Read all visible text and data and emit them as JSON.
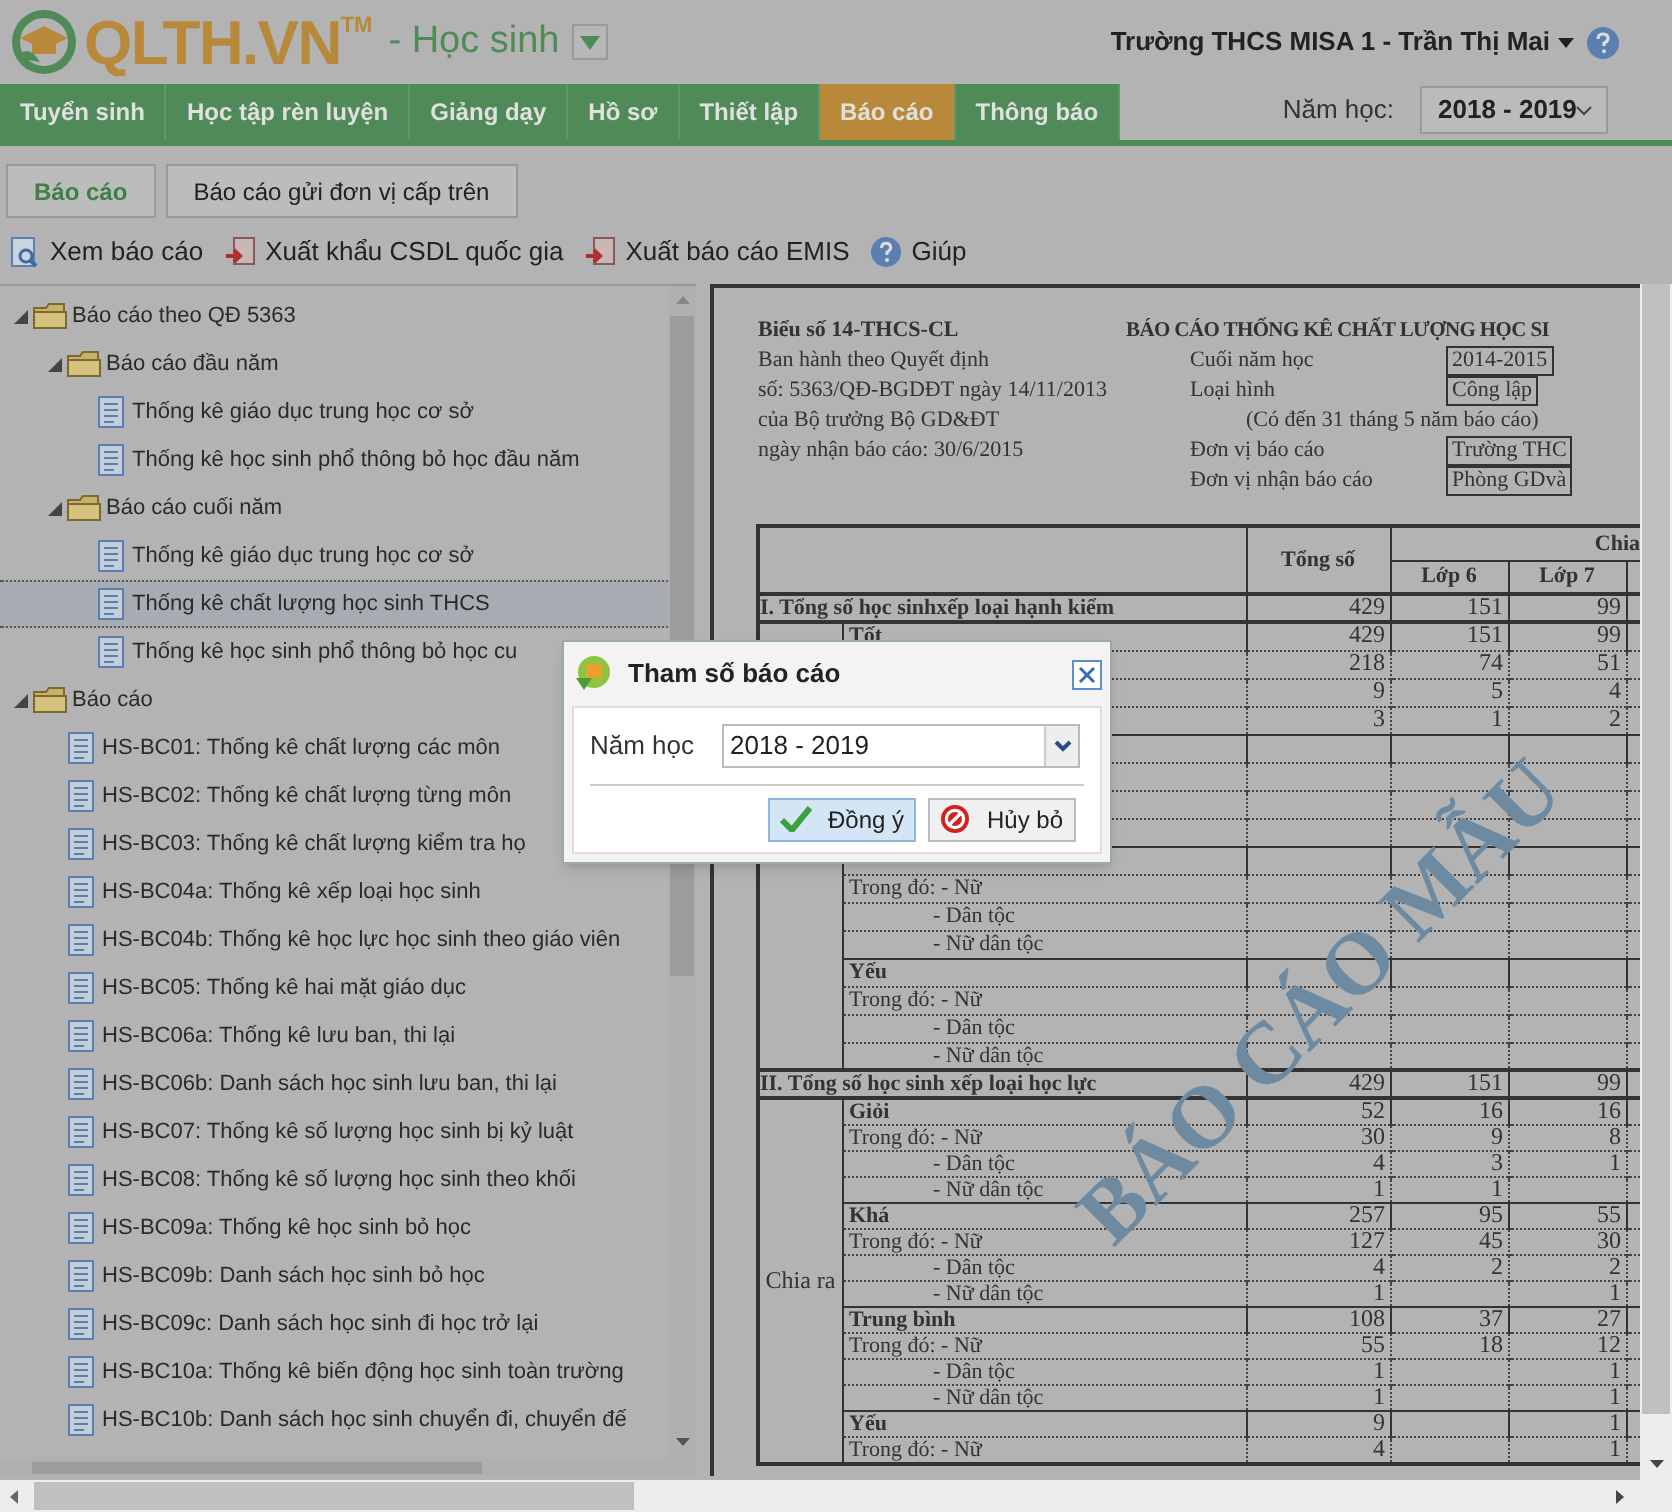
{
  "app": {
    "logo_text": "QLTH.VN",
    "trademark": "TM",
    "module": "- Học sinh"
  },
  "user_menu": {
    "label": "Trường THCS MISA 1 - Trần Thị Mai"
  },
  "nav_tabs": [
    {
      "label": "Tuyển sinh",
      "selected": false
    },
    {
      "label": "Học tập rèn luyện",
      "selected": false
    },
    {
      "label": "Giảng dạy",
      "selected": false
    },
    {
      "label": "Hồ sơ",
      "selected": false
    },
    {
      "label": "Thiết lập",
      "selected": false
    },
    {
      "label": "Báo cáo",
      "selected": true
    },
    {
      "label": "Thông báo",
      "selected": false
    }
  ],
  "school_year": {
    "label": "Năm học:",
    "value": "2018 - 2019"
  },
  "sub_tabs": [
    {
      "label": "Báo cáo",
      "selected": true
    },
    {
      "label": "Báo cáo gửi đơn vị cấp trên",
      "selected": false
    }
  ],
  "toolbar": [
    {
      "kind": "view",
      "label": "Xem báo cáo"
    },
    {
      "kind": "export",
      "label": "Xuất khẩu CSDL quốc gia"
    },
    {
      "kind": "export",
      "label": "Xuất báo cáo EMIS"
    },
    {
      "kind": "help",
      "label": "Giúp"
    }
  ],
  "tree": [
    {
      "kind": "folder",
      "label": "Báo cáo theo QĐ 5363",
      "expanded": true,
      "selected": false,
      "children": [
        {
          "kind": "folder",
          "label": "Báo cáo đầu năm",
          "expanded": true,
          "selected": false,
          "children": [
            {
              "kind": "report",
              "label": "Thống kê giáo dục trung học cơ sở",
              "selected": false
            },
            {
              "kind": "report",
              "label": "Thống kê học sinh phổ thông bỏ học đầu năm",
              "selected": false
            }
          ]
        },
        {
          "kind": "folder",
          "label": "Báo cáo cuối năm",
          "expanded": true,
          "selected": false,
          "children": [
            {
              "kind": "report",
              "label": "Thống kê giáo dục trung học cơ sở",
              "selected": false
            },
            {
              "kind": "report",
              "label": "Thống kê chất lượng học sinh THCS",
              "selected": true
            },
            {
              "kind": "report",
              "label": "Thống kê học sinh phổ thông bỏ học cu",
              "selected": false
            }
          ]
        }
      ]
    },
    {
      "kind": "folder",
      "label": "Báo cáo",
      "expanded": true,
      "selected": false,
      "children": [
        {
          "kind": "report",
          "label": "HS-BC01: Thống kê chất lượng các môn",
          "selected": false
        },
        {
          "kind": "report",
          "label": "HS-BC02: Thống kê chất lượng từng môn",
          "selected": false
        },
        {
          "kind": "report",
          "label": "HS-BC03: Thống kê chất lượng kiểm tra họ",
          "selected": false
        },
        {
          "kind": "report",
          "label": "HS-BC04a: Thống kê xếp loại học sinh",
          "selected": false
        },
        {
          "kind": "report",
          "label": "HS-BC04b: Thống kê học lực học sinh theo giáo viên",
          "selected": false
        },
        {
          "kind": "report",
          "label": "HS-BC05: Thống kê hai mặt giáo dục",
          "selected": false
        },
        {
          "kind": "report",
          "label": "HS-BC06a: Thống kê lưu ban, thi lại",
          "selected": false
        },
        {
          "kind": "report",
          "label": "HS-BC06b: Danh sách học sinh lưu ban, thi lại",
          "selected": false
        },
        {
          "kind": "report",
          "label": "HS-BC07: Thống kê số lượng học sinh bị kỷ luật",
          "selected": false
        },
        {
          "kind": "report",
          "label": "HS-BC08: Thống kê số lượng học sinh theo khối",
          "selected": false
        },
        {
          "kind": "report",
          "label": "HS-BC09a: Thống kê học sinh bỏ học",
          "selected": false
        },
        {
          "kind": "report",
          "label": "HS-BC09b: Danh sách học sinh bỏ học",
          "selected": false
        },
        {
          "kind": "report",
          "label": "HS-BC09c: Danh sách học sinh đi học trở lại",
          "selected": false
        },
        {
          "kind": "report",
          "label": "HS-BC10a: Thống kê biến động học sinh toàn trường",
          "selected": false
        },
        {
          "kind": "report",
          "label": "HS-BC10b: Danh sách học sinh chuyển đi, chuyển đế",
          "selected": false
        }
      ]
    }
  ],
  "report": {
    "form_code": "Biểu số 14-THCS-CL",
    "title": "BÁO CÁO THỐNG KÊ CHẤT LƯỢNG HỌC SI",
    "issued_lines": [
      "Ban hành theo Quyết định",
      "số: 5363/QĐ-BGDĐT ngày 14/11/2013",
      "của Bộ trưởng Bộ GD&ĐT",
      "ngày nhận báo cáo: 30/6/2015"
    ],
    "fields": [
      {
        "kind": "field",
        "label": "Cuối năm học",
        "value": "2014-2015"
      },
      {
        "kind": "field",
        "label": "Loại hình",
        "value": "Công lập"
      },
      {
        "kind": "note",
        "label": "(Có đến 31 tháng 5 năm báo cáo)"
      },
      {
        "kind": "field",
        "label": "Đơn vị báo cáo",
        "value": "Trường THC"
      },
      {
        "kind": "field",
        "label": "Đơn vị nhận báo cáo",
        "value": "Phòng GDvà"
      }
    ],
    "table": {
      "total_header": "Tổng số",
      "group_header": "Chia",
      "grade_headers": [
        "Lớp 6",
        "Lớp 7"
      ],
      "sections": [
        {
          "heading": "I. Tổng số học sinhxếp loại hạnh kiểm",
          "values": {
            "total": "429",
            "lop_6": "151",
            "lop_7": "99"
          },
          "rows": [
            {
              "kind": "level",
              "label": "Tốt",
              "values": {
                "total": "429",
                "lop_6": "151",
                "lop_7": "99"
              }
            },
            {
              "kind": "breakdown",
              "values": {
                "total": "218",
                "lop_6": "74",
                "lop_7": "51"
              }
            },
            {
              "kind": "detail",
              "values": {
                "total": "9",
                "lop_6": "5",
                "lop_7": "4"
              }
            },
            {
              "kind": "detail",
              "values": {
                "total": "3",
                "lop_6": "1",
                "lop_7": "2"
              }
            },
            {
              "kind": "level"
            },
            {
              "kind": "breakdown"
            },
            {
              "kind": "detail"
            },
            {
              "kind": "detail"
            },
            {
              "kind": "level"
            },
            {
              "kind": "breakdown",
              "label": "Trong đó: - Nữ"
            },
            {
              "kind": "detail",
              "label": "- Dân tộc"
            },
            {
              "kind": "detail",
              "label": "- Nữ dân tộc"
            },
            {
              "kind": "level",
              "label": "Yếu"
            },
            {
              "kind": "breakdown",
              "label": "Trong đó: - Nữ"
            },
            {
              "kind": "detail",
              "label": "- Dân tộc"
            },
            {
              "kind": "detail",
              "label": "- Nữ dân tộc"
            }
          ]
        },
        {
          "heading": "II. Tổng số học sinh xếp loại học lực",
          "values": {
            "total": "429",
            "lop_6": "151",
            "lop_7": "99"
          },
          "side_label": "Chia ra",
          "rows": [
            {
              "kind": "level",
              "label": "Giỏi",
              "values": {
                "total": "52",
                "lop_6": "16",
                "lop_7": "16"
              }
            },
            {
              "kind": "breakdown",
              "label": "Trong đó: - Nữ",
              "values": {
                "total": "30",
                "lop_6": "9",
                "lop_7": "8"
              }
            },
            {
              "kind": "detail",
              "label": "- Dân tộc",
              "values": {
                "total": "4",
                "lop_6": "3",
                "lop_7": "1"
              }
            },
            {
              "kind": "detail",
              "label": "- Nữ dân tộc",
              "values": {
                "total": "1",
                "lop_6": "1"
              }
            },
            {
              "kind": "level",
              "label": "Khá",
              "values": {
                "total": "257",
                "lop_6": "95",
                "lop_7": "55"
              }
            },
            {
              "kind": "breakdown",
              "label": "Trong đó: - Nữ",
              "values": {
                "total": "127",
                "lop_6": "45",
                "lop_7": "30"
              }
            },
            {
              "kind": "detail",
              "label": "- Dân tộc",
              "values": {
                "total": "4",
                "lop_6": "2",
                "lop_7": "2"
              }
            },
            {
              "kind": "detail",
              "label": "- Nữ dân tộc",
              "values": {
                "total": "1",
                "lop_7": "1"
              }
            },
            {
              "kind": "level",
              "label": "Trung bình",
              "values": {
                "total": "108",
                "lop_6": "37",
                "lop_7": "27"
              }
            },
            {
              "kind": "breakdown",
              "label": "Trong đó: - Nữ",
              "values": {
                "total": "55",
                "lop_6": "18",
                "lop_7": "12"
              }
            },
            {
              "kind": "detail",
              "label": "- Dân tộc",
              "values": {
                "total": "1",
                "lop_7": "1"
              }
            },
            {
              "kind": "detail",
              "label": "- Nữ dân tộc",
              "values": {
                "total": "1",
                "lop_7": "1"
              }
            },
            {
              "kind": "level",
              "label": "Yếu",
              "values": {
                "total": "9",
                "lop_7": "1"
              }
            },
            {
              "kind": "breakdown",
              "label": "Trong đó: - Nữ",
              "values": {
                "total": "4",
                "lop_7": "1"
              }
            }
          ]
        }
      ]
    },
    "watermark": "BÁO CÁO MẪU"
  },
  "dialog": {
    "title": "Tham số báo cáo",
    "field_label": "Năm học",
    "field_value": "2018 - 2019",
    "buttons": [
      {
        "kind": "confirm",
        "label": "Đồng ý"
      },
      {
        "kind": "cancel",
        "label": "Hủy bỏ"
      }
    ]
  }
}
